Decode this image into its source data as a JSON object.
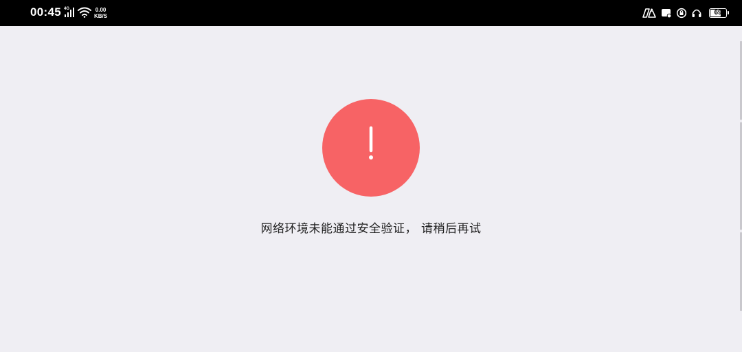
{
  "status_bar": {
    "time": "00:45",
    "network_type": "4G",
    "net_speed_value": "0.00",
    "net_speed_unit": "KB/S",
    "battery_level": "69",
    "battery_percent": 69
  },
  "error_page": {
    "symbol": "!",
    "message": "网络环境未能通过安全验证， 请稍后再试"
  },
  "colors": {
    "status_bar_bg": "#000000",
    "page_bg": "#efeef3",
    "error_accent": "#f76365"
  }
}
